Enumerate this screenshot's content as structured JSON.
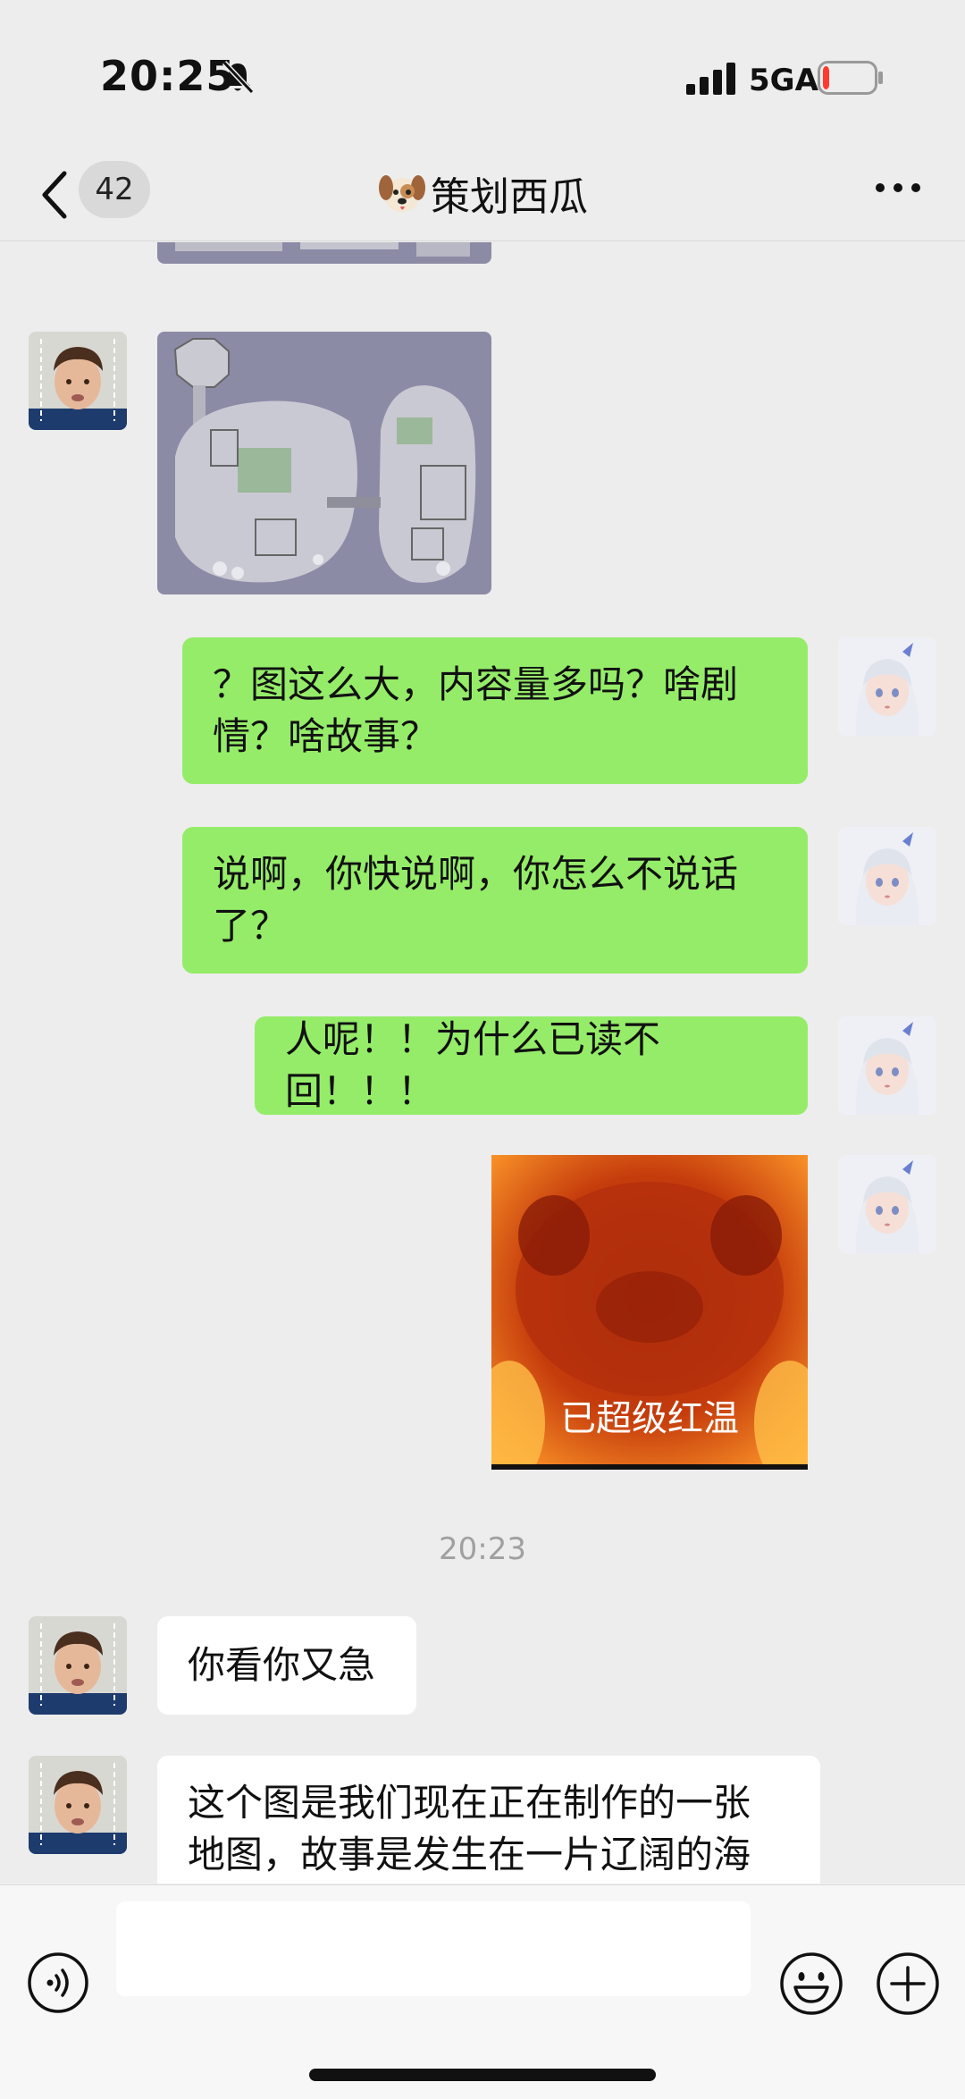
{
  "status_bar": {
    "time": "20:25",
    "network": "5GA",
    "battery_level": 0.12,
    "icons": [
      "bell-muted-icon",
      "signal-icon",
      "battery-icon"
    ]
  },
  "nav": {
    "unread_count": "42",
    "title": "策划西瓜",
    "icons": [
      "back-icon",
      "dog-face-icon",
      "more-icon"
    ]
  },
  "messages": [
    {
      "side": "left",
      "type": "image",
      "content": "map-image"
    },
    {
      "side": "right",
      "type": "text",
      "lines": [
        "？图这么大，内容量多吗？啥剧",
        "情？啥故事？"
      ]
    },
    {
      "side": "right",
      "type": "text",
      "lines": [
        "说啊，你快说啊，你怎么不说话",
        "了？"
      ]
    },
    {
      "side": "right",
      "type": "text",
      "lines": [
        "人呢！！为什么已读不回！！！"
      ]
    },
    {
      "side": "right",
      "type": "sticker",
      "caption": "已超级红温"
    },
    {
      "type": "timestamp",
      "text": "20:23"
    },
    {
      "side": "left",
      "type": "text",
      "lines": [
        "你看你又急"
      ]
    },
    {
      "side": "left",
      "type": "text",
      "lines": [
        "这个图是我们现在正在制作的一张",
        "地图，故事是发生在一片辽阔的海"
      ]
    }
  ],
  "input_bar": {
    "placeholder": "",
    "icons": [
      "voice-icon",
      "emoji-icon",
      "plus-icon"
    ]
  },
  "colors": {
    "background": "#ededed",
    "bubble_green": "#95ec69",
    "bubble_white": "#ffffff",
    "timestamp": "#a0a0a0"
  }
}
